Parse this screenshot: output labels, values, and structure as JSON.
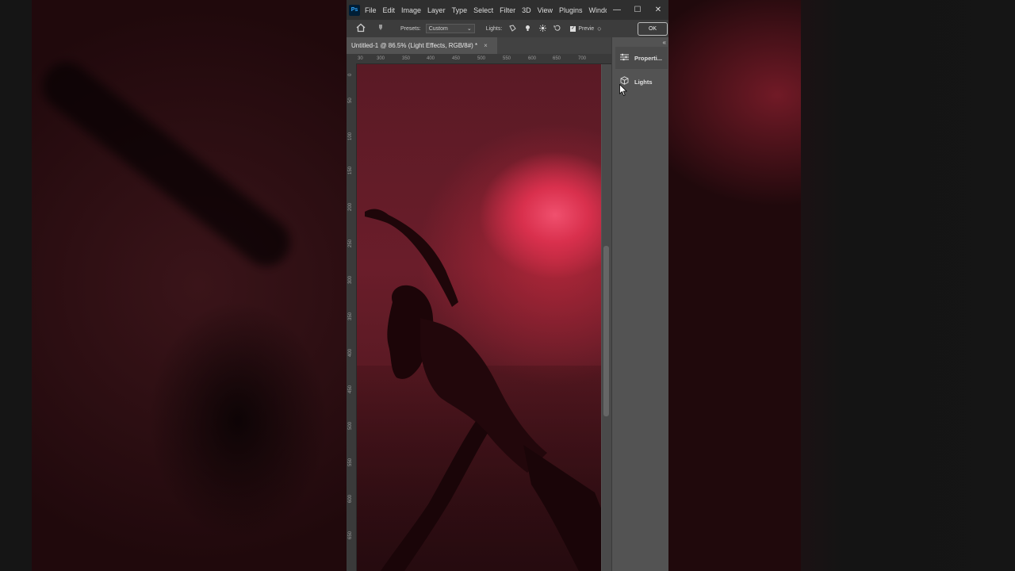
{
  "app": {
    "logo": "Ps",
    "menu": [
      "File",
      "Edit",
      "Image",
      "Layer",
      "Type",
      "Select",
      "Filter",
      "3D",
      "View",
      "Plugins",
      "Windo"
    ],
    "window_controls": {
      "minimize": "—",
      "maximize": "☐",
      "close": "✕"
    }
  },
  "options": {
    "presets_label": "Presets:",
    "preset_value": "Custom",
    "lights_label": "Lights:",
    "preview_label": "Previe",
    "ok_label": "OK"
  },
  "document": {
    "tab_title": "Untitled-1 @ 86.5% (Light Effects, RGB/8#) *",
    "close": "×",
    "ruler_h": [
      "30",
      "300",
      "350",
      "400",
      "450",
      "500",
      "550",
      "600",
      "650",
      "700"
    ],
    "ruler_v": [
      "0",
      "50",
      "100",
      "150",
      "200",
      "250",
      "300",
      "350",
      "400",
      "450",
      "500",
      "550",
      "600",
      "650"
    ]
  },
  "panel": {
    "collapse": "«",
    "properties_label": "Properti...",
    "lights_label": "Lights"
  }
}
